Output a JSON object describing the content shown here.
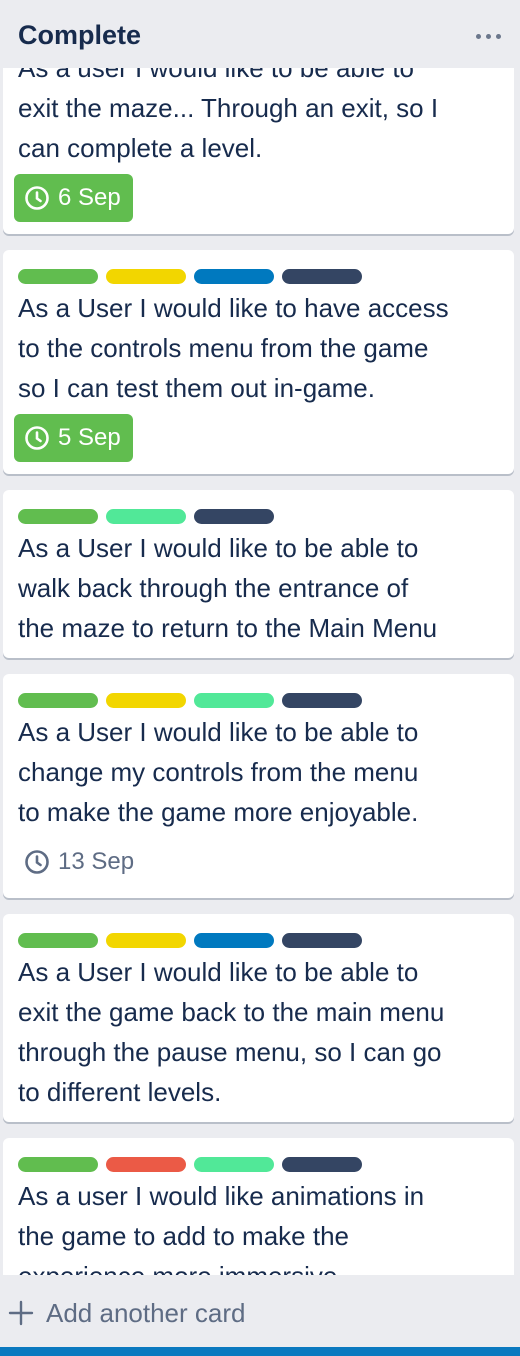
{
  "list": {
    "title": "Complete",
    "menu_icon": "ellipsis-icon",
    "add_card_label": "Add another card",
    "add_card_icon": "plus-icon"
  },
  "label_colors": {
    "green": "#61bd4f",
    "yellow": "#f2d600",
    "blue": "#0079bf",
    "navy": "#344563",
    "lime": "#51e898",
    "red": "#eb5a46"
  },
  "cards": [
    {
      "labels": [],
      "title_lines": [
        "As a user I would like to be able to",
        "exit the maze... Through an exit, so I",
        "can complete a level."
      ],
      "due": {
        "text": "6 Sep",
        "icon": "clock-icon",
        "complete": true
      }
    },
    {
      "labels": [
        "green",
        "yellow",
        "blue",
        "navy"
      ],
      "title_lines": [
        "As a User I would like to have access",
        "to the controls menu from the game",
        "so I can test them out in-game."
      ],
      "due": {
        "text": "5 Sep",
        "icon": "clock-icon",
        "complete": true
      }
    },
    {
      "labels": [
        "green",
        "lime",
        "navy"
      ],
      "title_lines": [
        "As a User I would like to be able to",
        "walk back through the entrance of",
        "the maze to return to the Main Menu"
      ]
    },
    {
      "labels": [
        "green",
        "yellow",
        "lime",
        "navy"
      ],
      "title_lines": [
        "As a User I would like to be able to",
        "change my controls from the menu",
        "to make the game more enjoyable."
      ],
      "due": {
        "text": "13 Sep",
        "icon": "clock-icon",
        "complete": false
      }
    },
    {
      "labels": [
        "green",
        "yellow",
        "blue",
        "navy"
      ],
      "title_lines": [
        "As a User I would like to be able to",
        "exit the game back to the main menu",
        "through the pause menu, so I can go",
        "to different levels."
      ]
    },
    {
      "labels": [
        "green",
        "red",
        "lime",
        "navy"
      ],
      "title_lines": [
        "As a user I would like animations in",
        "the game to add to make the",
        "experience more immersive."
      ]
    }
  ]
}
